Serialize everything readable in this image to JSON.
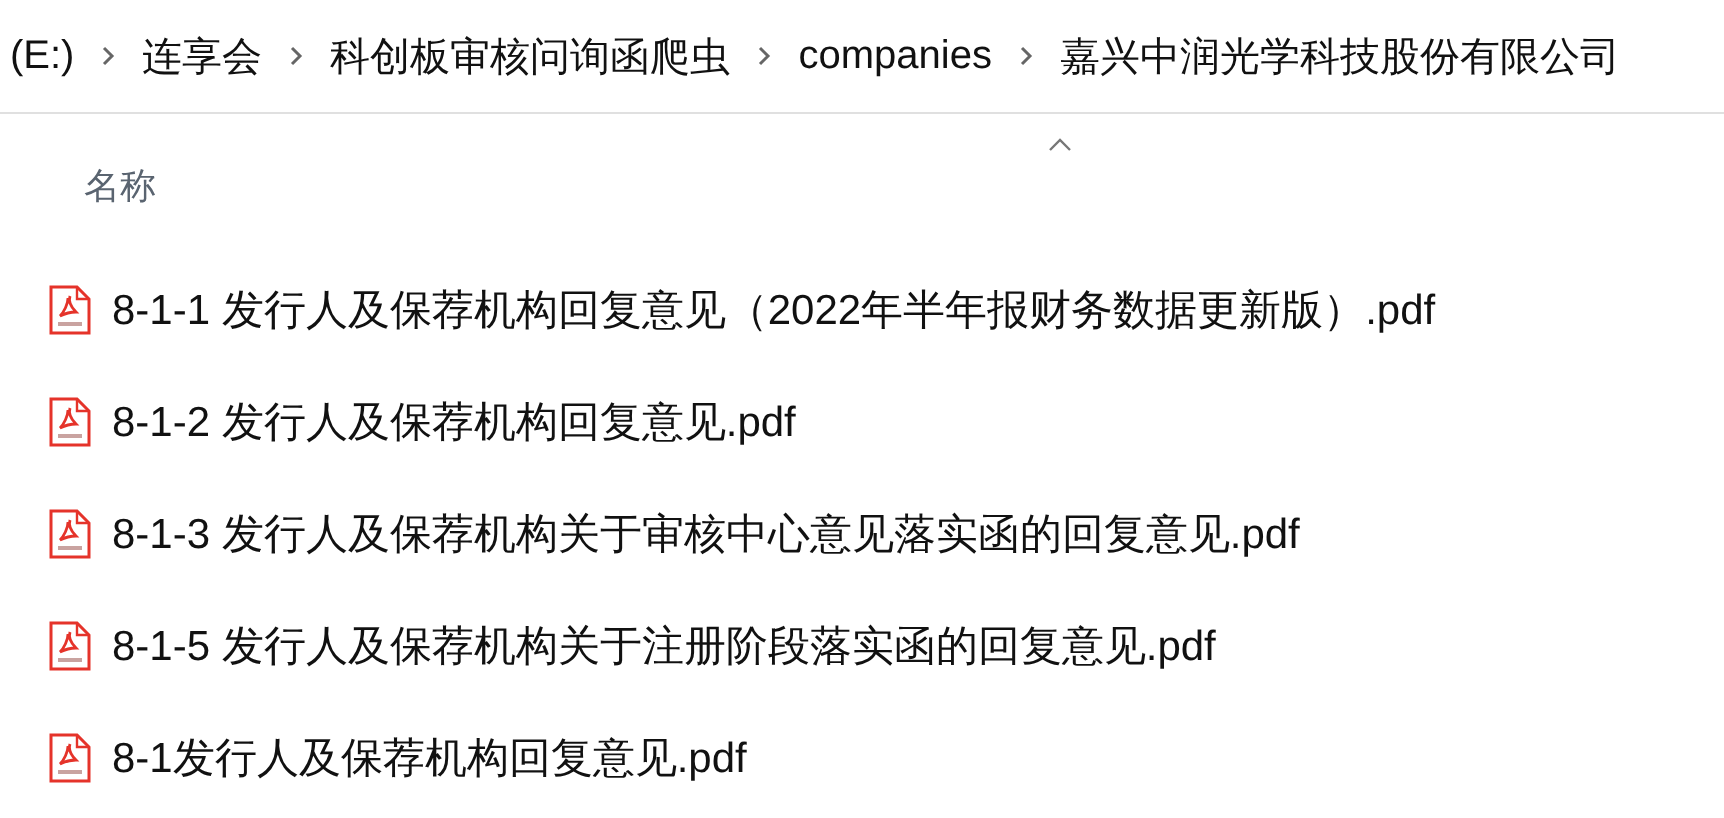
{
  "breadcrumb": [
    "(E:)",
    "连享会",
    "科创板审核问询函爬虫",
    "companies",
    "嘉兴中润光学科技股份有限公司"
  ],
  "columns": [
    {
      "label": "名称",
      "sorted": true
    }
  ],
  "files": [
    {
      "name": "8-1-1 发行人及保荐机构回复意见（2022年半年报财务数据更新版）.pdf",
      "kind": "pdf"
    },
    {
      "name": "8-1-2 发行人及保荐机构回复意见.pdf",
      "kind": "pdf"
    },
    {
      "name": "8-1-3 发行人及保荐机构关于审核中心意见落实函的回复意见.pdf",
      "kind": "pdf"
    },
    {
      "name": "8-1-5 发行人及保荐机构关于注册阶段落实函的回复意见.pdf",
      "kind": "pdf"
    },
    {
      "name": "8-1发行人及保荐机构回复意见.pdf",
      "kind": "pdf"
    }
  ]
}
